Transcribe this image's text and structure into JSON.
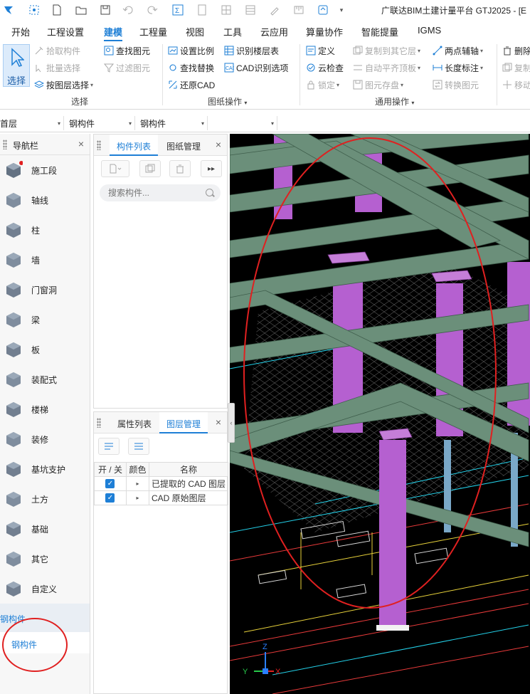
{
  "app": {
    "title": "广联达BIM土建计量平台 GTJ2025 - [E"
  },
  "menu": {
    "tabs": [
      "开始",
      "工程设置",
      "建模",
      "工程量",
      "视图",
      "工具",
      "云应用",
      "算量协作",
      "智能提量",
      "IGMS"
    ],
    "active": "建模"
  },
  "ribbon": {
    "select_label": "选择",
    "select_group": {
      "pick": "拾取构件",
      "batch": "批量选择",
      "by_layer": "按图层选择",
      "find": "查找图元",
      "filter": "过滤图元",
      "group_label": "选择"
    },
    "drawing_group": {
      "set_scale": "设置比例",
      "identify_floors": "识别楼层表",
      "find_replace": "查找替换",
      "cad_options": "CAD识别选项",
      "restore_cad": "还原CAD",
      "group_label": "图纸操作"
    },
    "common_group": {
      "define": "定义",
      "copy_floors": "复制到其它层",
      "two_point_axis": "两点辅轴",
      "cloud_check": "云检查",
      "auto_flat": "自动平齐顶板",
      "length_dim": "长度标注",
      "lock": "锁定",
      "save_element": "图元存盘",
      "convert_element": "转换图元",
      "delete": "删除",
      "copy": "复制",
      "move": "移动",
      "group_label": "通用操作"
    }
  },
  "dropdowns": {
    "floor": "首层",
    "type1": "钢构件",
    "type2": "钢构件"
  },
  "nav": {
    "title": "导航栏",
    "items": [
      "施工段",
      "轴线",
      "柱",
      "墙",
      "门窗洞",
      "梁",
      "板",
      "装配式",
      "楼梯",
      "装修",
      "基坑支护",
      "土方",
      "基础",
      "其它",
      "自定义"
    ],
    "section": "钢构件",
    "section_item": "钢构件"
  },
  "component_panel": {
    "tab_list": "构件列表",
    "tab_drawing": "图纸管理",
    "search_placeholder": "搜索构件..."
  },
  "layer_panel": {
    "tab_props": "属性列表",
    "tab_layers": "图层管理",
    "columns": [
      "开 / 关",
      "颜色",
      "名称"
    ],
    "rows": [
      {
        "on": true,
        "name": "已提取的 CAD 图层"
      },
      {
        "on": true,
        "name": "CAD 原始图层"
      }
    ]
  },
  "viewport": {
    "axis_labels": [
      "Z",
      "Y",
      "X"
    ]
  },
  "colors": {
    "accent": "#1e7fd6",
    "beam": "#6b8f7a",
    "column": "#b560d0",
    "annotation_circle": "#e02020"
  }
}
